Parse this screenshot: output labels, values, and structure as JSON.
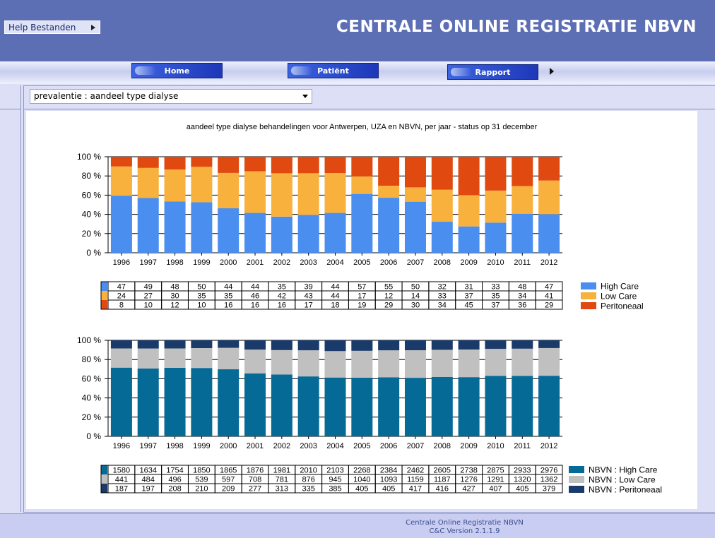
{
  "header": {
    "title": "CENTRALE ONLINE REGISTRATIE NBVN",
    "help_label": "Help Bestanden"
  },
  "nav": {
    "home": "Home",
    "patient": "Patiënt",
    "rapport": "Rapport"
  },
  "report_select": {
    "value": "prevalentie : aandeel type dialyse"
  },
  "chart_title": "aandeel type dialyse behandelingen voor Antwerpen, UZA en NBVN, per jaar - status op 31 december",
  "footer": {
    "line1": "Centrale Online Registratie NBVN",
    "line2": "C&C Version 2.1.1.9"
  },
  "chart_data": [
    {
      "type": "bar",
      "stacked": "percent",
      "categories": [
        "1996",
        "1997",
        "1998",
        "1999",
        "2000",
        "2001",
        "2002",
        "2003",
        "2004",
        "2005",
        "2006",
        "2007",
        "2008",
        "2009",
        "2010",
        "2011",
        "2012"
      ],
      "yticks": [
        "0 %",
        "20 %",
        "40 %",
        "60 %",
        "80 %",
        "100 %"
      ],
      "ylim": [
        0,
        100
      ],
      "grid": true,
      "legend_position": "right of data table",
      "series": [
        {
          "name": "High Care",
          "color": "#4a8ef0",
          "values": [
            47,
            49,
            48,
            50,
            44,
            44,
            35,
            39,
            44,
            57,
            55,
            50,
            32,
            31,
            33,
            48,
            47
          ]
        },
        {
          "name": "Low Care",
          "color": "#f9b13d",
          "values": [
            24,
            27,
            30,
            35,
            35,
            46,
            42,
            43,
            44,
            17,
            12,
            14,
            33,
            37,
            35,
            34,
            41
          ]
        },
        {
          "name": "Peritoneaal",
          "color": "#e04a10",
          "values": [
            8,
            10,
            12,
            10,
            16,
            16,
            16,
            17,
            18,
            19,
            29,
            30,
            34,
            45,
            37,
            36,
            29
          ]
        }
      ]
    },
    {
      "type": "bar",
      "stacked": "percent",
      "categories": [
        "1996",
        "1997",
        "1998",
        "1999",
        "2000",
        "2001",
        "2002",
        "2003",
        "2004",
        "2005",
        "2006",
        "2007",
        "2008",
        "2009",
        "2010",
        "2011",
        "2012"
      ],
      "yticks": [
        "0 %",
        "20 %",
        "40 %",
        "60 %",
        "80 %",
        "100 %"
      ],
      "ylim": [
        0,
        100
      ],
      "grid": true,
      "legend_position": "right of data table",
      "series": [
        {
          "name": "NBVN : High Care",
          "color": "#066a97",
          "values": [
            1580,
            1634,
            1754,
            1850,
            1865,
            1876,
            1981,
            2010,
            2103,
            2268,
            2384,
            2462,
            2605,
            2738,
            2875,
            2933,
            2976
          ]
        },
        {
          "name": "NBVN : Low Care",
          "color": "#c0c0c0",
          "values": [
            441,
            484,
            496,
            539,
            597,
            708,
            781,
            876,
            945,
            1040,
            1093,
            1159,
            1187,
            1276,
            1291,
            1320,
            1362
          ]
        },
        {
          "name": "NBVN : Peritoneaal",
          "color": "#1a3a6a",
          "values": [
            187,
            197,
            208,
            210,
            209,
            277,
            313,
            335,
            385,
            405,
            405,
            417,
            416,
            427,
            407,
            405,
            379
          ]
        }
      ]
    }
  ]
}
